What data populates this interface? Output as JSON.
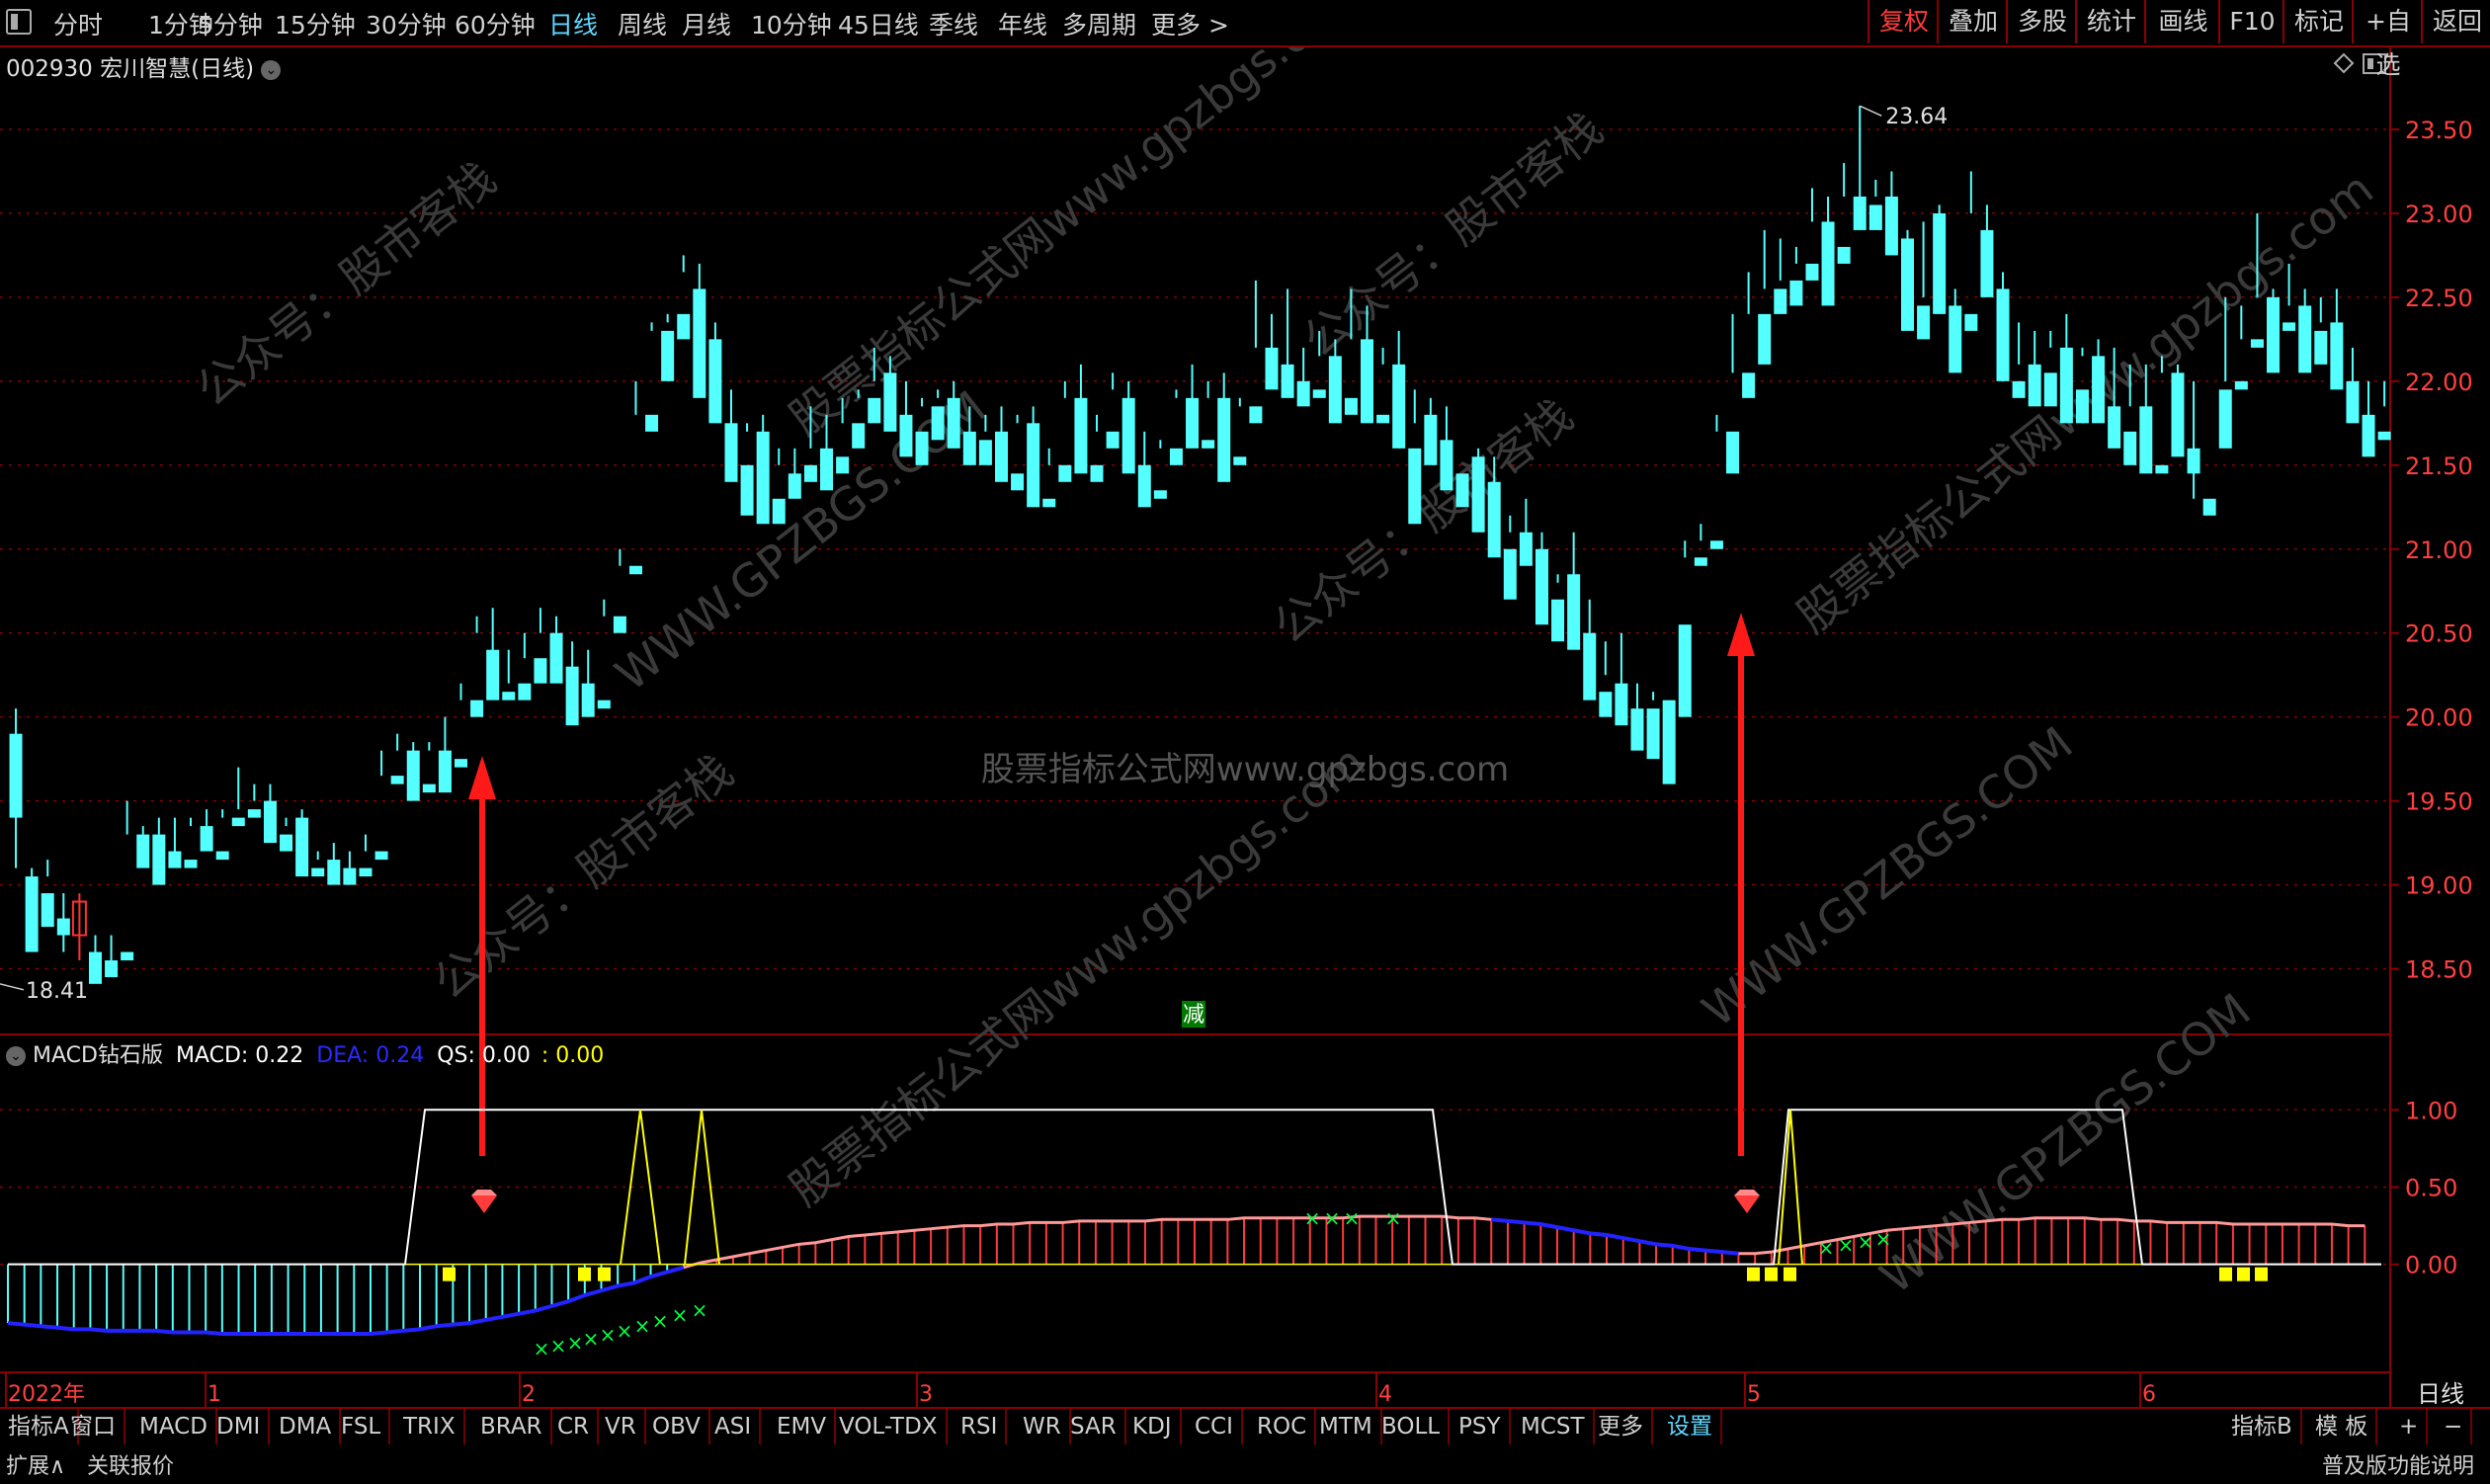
{
  "toolbar": {
    "window_icon": "window-toggle-icon",
    "periods": [
      "分时",
      "1分钟",
      "5分钟",
      "15分钟",
      "30分钟",
      "60分钟",
      "日线",
      "周线",
      "月线",
      "10分钟",
      "45日线",
      "季线",
      "年线",
      "多周期",
      "更多 >"
    ],
    "active_period": "日线",
    "right_buttons": [
      "复权",
      "叠加",
      "多股",
      "统计",
      "画线",
      "F10",
      "标记",
      "+自选",
      "返回"
    ]
  },
  "stock": {
    "title": "002930 宏川智慧(日线)"
  },
  "indicator": {
    "name": "MACD钻石版",
    "macd_label": "MACD: 0.22",
    "dea_label": "DEA: 0.24",
    "qs_label": "QS: 0.00",
    "extra_label": ": 0.00",
    "colors": {
      "macd": "#ffffff",
      "dea": "#0000ff",
      "qs": "#ffffff",
      "extra": "#ffff00"
    }
  },
  "chart_data": {
    "type": "candlestick",
    "price_axis_ticks": [
      "23.50",
      "23.00",
      "22.50",
      "22.00",
      "21.50",
      "21.00",
      "20.50",
      "20.00",
      "19.50",
      "19.00",
      "18.50"
    ],
    "price_ylim": [
      18.15,
      23.8
    ],
    "indicator_axis_ticks": [
      "1.00",
      "0.50",
      "0.00"
    ],
    "x_labels": [
      "2022年",
      "1",
      "2",
      "3",
      "4",
      "5",
      "6"
    ],
    "max_label": "23.64",
    "min_label": "18.41",
    "annotation": "减",
    "watermarks": [
      "公众号：股市客栈",
      "股票指标公式网www.gpzbgs.com",
      "WWW.GPZBGS.COM"
    ],
    "candles": [
      [
        19.9,
        20.05,
        19.4,
        19.1
      ],
      [
        19.05,
        19.1,
        18.6,
        18.8
      ],
      [
        18.95,
        19.15,
        18.75,
        19.05
      ],
      [
        18.8,
        18.95,
        18.7,
        18.6
      ],
      [
        18.7,
        18.95,
        18.9,
        18.55
      ],
      [
        18.6,
        18.7,
        18.41,
        18.5
      ],
      [
        18.55,
        18.7,
        18.45,
        18.55
      ],
      [
        18.6,
        19.5,
        18.55,
        19.3
      ],
      [
        19.3,
        19.35,
        19.1,
        19.3
      ],
      [
        19.3,
        19.4,
        19.0,
        19.3
      ],
      [
        19.2,
        19.4,
        19.1,
        19.15
      ],
      [
        19.15,
        19.4,
        19.1,
        19.35
      ],
      [
        19.35,
        19.45,
        19.2,
        19.25
      ],
      [
        19.2,
        19.45,
        19.15,
        19.4
      ],
      [
        19.4,
        19.7,
        19.35,
        19.45
      ],
      [
        19.45,
        19.6,
        19.4,
        19.5
      ],
      [
        19.5,
        19.6,
        19.25,
        19.3
      ],
      [
        19.3,
        19.4,
        19.2,
        19.35
      ],
      [
        19.4,
        19.45,
        19.05,
        19.1
      ],
      [
        19.1,
        19.2,
        19.05,
        19.15
      ],
      [
        19.15,
        19.25,
        19.0,
        19.1
      ],
      [
        19.1,
        19.2,
        19.0,
        19.1
      ],
      [
        19.1,
        19.3,
        19.05,
        19.2
      ],
      [
        19.2,
        19.8,
        19.15,
        19.65
      ],
      [
        19.65,
        19.9,
        19.6,
        19.8
      ],
      [
        19.8,
        19.85,
        19.5,
        19.6
      ],
      [
        19.6,
        19.85,
        19.55,
        19.8
      ],
      [
        19.8,
        20.0,
        19.55,
        19.7
      ],
      [
        19.75,
        20.2,
        19.7,
        20.1
      ],
      [
        20.1,
        20.6,
        20.0,
        20.5
      ],
      [
        20.4,
        20.65,
        20.1,
        20.15
      ],
      [
        20.15,
        20.4,
        20.1,
        20.2
      ],
      [
        20.2,
        20.5,
        20.1,
        20.35
      ],
      [
        20.35,
        20.65,
        20.2,
        20.5
      ],
      [
        20.5,
        20.6,
        20.2,
        20.3
      ],
      [
        20.3,
        20.45,
        19.95,
        20.2
      ],
      [
        20.2,
        20.4,
        20.0,
        20.1
      ],
      [
        20.1,
        20.7,
        20.05,
        20.6
      ],
      [
        20.6,
        21.0,
        20.5,
        20.9
      ],
      [
        20.9,
        22.0,
        20.85,
        21.8
      ],
      [
        21.8,
        22.35,
        21.7,
        22.3
      ],
      [
        22.3,
        22.4,
        22.0,
        22.35
      ],
      [
        22.4,
        22.75,
        22.25,
        22.65
      ],
      [
        22.55,
        22.7,
        21.9,
        21.95
      ],
      [
        22.25,
        22.35,
        21.75,
        21.8
      ],
      [
        21.75,
        21.95,
        21.4,
        21.55
      ],
      [
        21.5,
        21.75,
        21.2,
        21.7
      ],
      [
        21.7,
        21.8,
        21.15,
        21.3
      ],
      [
        21.3,
        21.6,
        21.15,
        21.5
      ],
      [
        21.45,
        21.6,
        21.3,
        21.4
      ],
      [
        21.5,
        21.85,
        21.4,
        21.6
      ],
      [
        21.6,
        21.8,
        21.35,
        21.55
      ],
      [
        21.55,
        21.9,
        21.45,
        21.75
      ],
      [
        21.75,
        21.95,
        21.6,
        21.9
      ],
      [
        21.9,
        22.2,
        21.75,
        22.0
      ],
      [
        22.05,
        22.15,
        21.7,
        21.8
      ],
      [
        21.8,
        22.0,
        21.55,
        21.7
      ],
      [
        21.7,
        21.9,
        21.5,
        21.85
      ],
      [
        21.85,
        21.95,
        21.65,
        21.9
      ],
      [
        21.9,
        22.0,
        21.6,
        21.7
      ],
      [
        21.7,
        21.85,
        21.5,
        21.65
      ],
      [
        21.65,
        21.8,
        21.5,
        21.7
      ],
      [
        21.7,
        21.85,
        21.4,
        21.45
      ],
      [
        21.45,
        21.8,
        21.35,
        21.75
      ],
      [
        21.75,
        21.85,
        21.25,
        21.3
      ],
      [
        21.3,
        21.6,
        21.25,
        21.5
      ],
      [
        21.5,
        22.0,
        21.4,
        21.9
      ],
      [
        21.9,
        22.1,
        21.45,
        21.5
      ],
      [
        21.5,
        21.8,
        21.4,
        21.7
      ],
      [
        21.7,
        22.05,
        21.6,
        21.95
      ],
      [
        21.9,
        22.0,
        21.45,
        21.5
      ],
      [
        21.5,
        21.7,
        21.25,
        21.35
      ],
      [
        21.35,
        21.65,
        21.3,
        21.6
      ],
      [
        21.6,
        21.95,
        21.5,
        21.9
      ],
      [
        21.9,
        22.1,
        21.6,
        21.65
      ],
      [
        21.65,
        22.0,
        21.6,
        21.9
      ],
      [
        21.9,
        22.05,
        21.4,
        21.55
      ],
      [
        21.55,
        21.9,
        21.5,
        21.85
      ],
      [
        21.85,
        22.6,
        21.75,
        22.2
      ],
      [
        22.2,
        22.4,
        21.95,
        22.1
      ],
      [
        22.1,
        22.55,
        21.9,
        22.0
      ],
      [
        22.0,
        22.2,
        21.85,
        21.95
      ],
      [
        21.95,
        22.3,
        21.9,
        22.15
      ],
      [
        22.15,
        22.25,
        21.75,
        21.9
      ],
      [
        21.9,
        22.55,
        21.8,
        22.25
      ],
      [
        22.25,
        22.45,
        21.75,
        21.9
      ],
      [
        21.8,
        22.2,
        21.75,
        22.1
      ],
      [
        22.1,
        22.3,
        21.6,
        21.6
      ],
      [
        21.6,
        21.95,
        21.15,
        21.75
      ],
      [
        21.8,
        21.9,
        21.5,
        21.65
      ],
      [
        21.65,
        21.85,
        21.35,
        21.45
      ],
      [
        21.45,
        21.55,
        21.25,
        21.55
      ],
      [
        21.55,
        21.6,
        21.1,
        21.4
      ],
      [
        21.4,
        21.55,
        20.95,
        21.0
      ],
      [
        21.0,
        21.2,
        20.7,
        21.1
      ],
      [
        21.1,
        21.3,
        20.9,
        21.05
      ],
      [
        21.0,
        21.1,
        20.55,
        20.7
      ],
      [
        20.7,
        20.85,
        20.45,
        20.8
      ],
      [
        20.85,
        21.1,
        20.4,
        20.5
      ],
      [
        20.5,
        20.7,
        20.1,
        20.15
      ],
      [
        20.15,
        20.45,
        20.0,
        20.25
      ],
      [
        20.2,
        20.5,
        19.95,
        20.05
      ],
      [
        20.05,
        20.2,
        19.8,
        20.05
      ],
      [
        20.05,
        20.15,
        19.75,
        20.1
      ],
      [
        20.1,
        20.55,
        19.6,
        20.55
      ],
      [
        20.55,
        21.05,
        20.0,
        20.95
      ],
      [
        20.95,
        21.15,
        20.9,
        21.05
      ],
      [
        21.05,
        21.8,
        21.0,
        21.7
      ],
      [
        21.7,
        22.4,
        21.45,
        22.05
      ],
      [
        22.05,
        22.65,
        21.9,
        22.4
      ],
      [
        22.4,
        22.9,
        22.1,
        22.55
      ],
      [
        22.55,
        22.85,
        22.4,
        22.6
      ],
      [
        22.6,
        22.8,
        22.45,
        22.7
      ],
      [
        22.7,
        23.15,
        22.6,
        22.95
      ],
      [
        22.95,
        23.1,
        22.45,
        22.5
      ],
      [
        22.8,
        23.3,
        22.7,
        23.1
      ],
      [
        23.1,
        23.64,
        22.9,
        23.05
      ],
      [
        23.05,
        23.2,
        22.9,
        23.1
      ],
      [
        23.1,
        23.25,
        22.75,
        22.85
      ],
      [
        22.85,
        22.9,
        22.3,
        22.45
      ],
      [
        22.45,
        22.95,
        22.25,
        22.5
      ],
      [
        23.0,
        23.05,
        22.4,
        22.45
      ],
      [
        22.45,
        22.55,
        22.05,
        22.4
      ],
      [
        22.4,
        23.25,
        22.3,
        23.0
      ],
      [
        22.9,
        23.05,
        22.5,
        22.55
      ],
      [
        22.55,
        22.65,
        22.0,
        22.0
      ],
      [
        22.0,
        22.35,
        21.9,
        22.1
      ],
      [
        22.1,
        22.3,
        21.85,
        22.05
      ],
      [
        22.05,
        22.3,
        21.85,
        22.2
      ],
      [
        22.2,
        22.4,
        21.75,
        21.95
      ],
      [
        21.95,
        22.2,
        21.75,
        22.15
      ],
      [
        22.15,
        22.25,
        21.75,
        21.85
      ],
      [
        21.85,
        22.2,
        21.6,
        21.7
      ],
      [
        21.7,
        22.1,
        21.5,
        21.85
      ],
      [
        21.85,
        22.1,
        21.45,
        21.5
      ],
      [
        21.5,
        22.15,
        21.45,
        22.05
      ],
      [
        22.05,
        22.1,
        21.55,
        21.6
      ],
      [
        21.6,
        22.0,
        21.45,
        21.3
      ],
      [
        21.3,
        21.95,
        21.2,
        21.95
      ],
      [
        21.95,
        22.5,
        21.6,
        22.0
      ],
      [
        22.0,
        22.45,
        21.95,
        22.25
      ],
      [
        22.25,
        23.0,
        22.2,
        22.5
      ],
      [
        22.5,
        22.55,
        22.05,
        22.35
      ],
      [
        22.35,
        22.7,
        22.3,
        22.45
      ],
      [
        22.45,
        22.55,
        22.05,
        22.3
      ],
      [
        22.3,
        22.5,
        22.1,
        22.35
      ],
      [
        22.35,
        22.55,
        21.95,
        22.0
      ],
      [
        22.0,
        22.2,
        21.75,
        21.8
      ],
      [
        21.8,
        22.0,
        21.55,
        21.7
      ],
      [
        21.7,
        22.0,
        21.65,
        21.85
      ]
    ],
    "macd_hist": [
      -0.38,
      -0.39,
      -0.4,
      -0.41,
      -0.42,
      -0.42,
      -0.43,
      -0.43,
      -0.43,
      -0.43,
      -0.44,
      -0.44,
      -0.44,
      -0.45,
      -0.45,
      -0.45,
      -0.45,
      -0.45,
      -0.45,
      -0.45,
      -0.45,
      -0.45,
      -0.45,
      -0.44,
      -0.43,
      -0.42,
      -0.4,
      -0.39,
      -0.38,
      -0.36,
      -0.34,
      -0.32,
      -0.3,
      -0.27,
      -0.24,
      -0.2,
      -0.17,
      -0.14,
      -0.12,
      -0.08,
      -0.05,
      -0.02,
      0.01,
      0.03,
      0.05,
      0.07,
      0.09,
      0.11,
      0.13,
      0.14,
      0.16,
      0.18,
      0.19,
      0.2,
      0.21,
      0.22,
      0.23,
      0.24,
      0.25,
      0.25,
      0.26,
      0.26,
      0.27,
      0.27,
      0.27,
      0.28,
      0.28,
      0.28,
      0.28,
      0.28,
      0.29,
      0.29,
      0.29,
      0.29,
      0.29,
      0.3,
      0.3,
      0.3,
      0.3,
      0.3,
      0.3,
      0.3,
      0.31,
      0.31,
      0.31,
      0.31,
      0.31,
      0.31,
      0.3,
      0.3,
      0.29,
      0.28,
      0.27,
      0.26,
      0.24,
      0.22,
      0.2,
      0.19,
      0.17,
      0.15,
      0.13,
      0.12,
      0.1,
      0.09,
      0.08,
      0.07,
      0.07,
      0.08,
      0.1,
      0.12,
      0.14,
      0.16,
      0.18,
      0.2,
      0.22,
      0.23,
      0.24,
      0.25,
      0.26,
      0.27,
      0.28,
      0.29,
      0.29,
      0.3,
      0.3,
      0.3,
      0.3,
      0.29,
      0.29,
      0.28,
      0.28,
      0.27,
      0.27,
      0.27,
      0.27,
      0.26,
      0.26,
      0.26,
      0.26,
      0.26,
      0.26,
      0.26,
      0.25,
      0.25
    ],
    "ind_ylim": [
      -0.68,
      1.2
    ]
  },
  "bottom_tabs": [
    "指标A",
    "窗口",
    "MACD",
    "DMI",
    "DMA",
    "FSL",
    "TRIX",
    "BRAR",
    "CR",
    "VR",
    "OBV",
    "ASI",
    "EMV",
    "VOL-TDX",
    "RSI",
    "WR",
    "SAR",
    "KDJ",
    "CCI",
    "ROC",
    "MTM",
    "BOLL",
    "PSY",
    "MCST",
    "更多",
    "设置"
  ],
  "bottom_active": "设置",
  "bottom_right": [
    "指标B",
    "模 板",
    "+",
    "−"
  ],
  "period_label": "日线",
  "status": {
    "expand": "扩展∧",
    "linked": "关联报价",
    "help": "普及版功能说明"
  }
}
